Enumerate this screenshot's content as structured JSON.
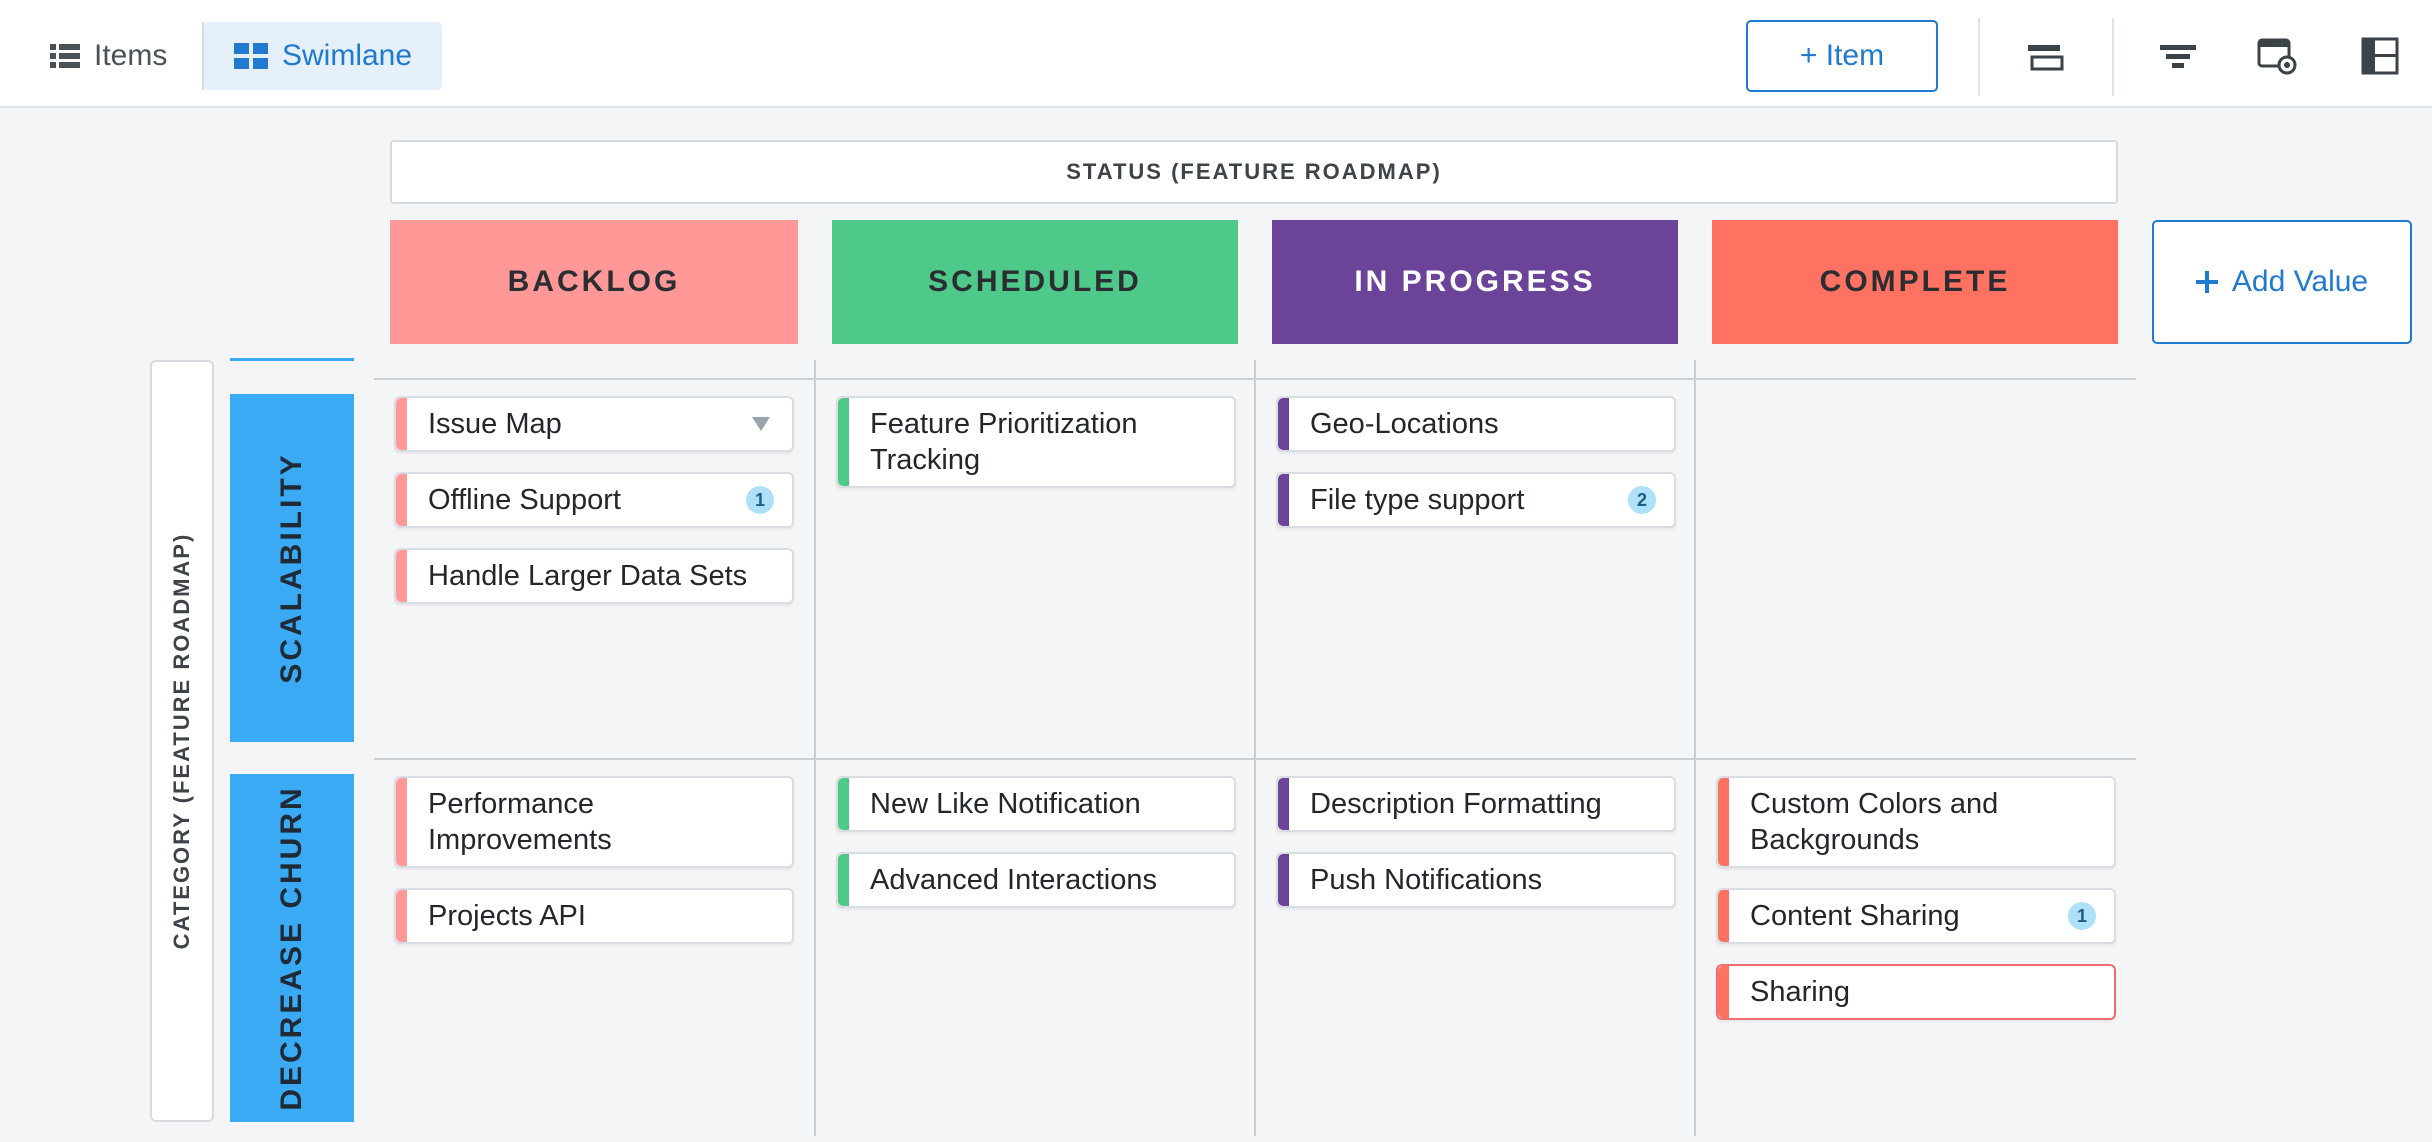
{
  "toolbar": {
    "tabs": [
      {
        "label": "Items",
        "icon": "list-icon"
      },
      {
        "label": "Swimlane",
        "icon": "grid-icon"
      }
    ],
    "add_item_label": "+ Item",
    "tools": [
      "collapse-icon",
      "filter-icon",
      "view-settings-icon",
      "layout-icon"
    ]
  },
  "board": {
    "status_title": "STATUS (FEATURE ROADMAP)",
    "category_title": "CATEGORY (FEATURE ROADMAP)",
    "add_value_label": "Add Value",
    "columns": [
      {
        "label": "BACKLOG",
        "color": "#ff9896"
      },
      {
        "label": "SCHEDULED",
        "color": "#4fc98a"
      },
      {
        "label": "IN PROGRESS",
        "color": "#6b4399"
      },
      {
        "label": "COMPLETE",
        "color": "#ff7160"
      }
    ],
    "row_color": "#3aaaf5",
    "rows": [
      {
        "label": "SCALABILITY",
        "cells": [
          [
            {
              "title": "Issue Map",
              "dropdown": true
            },
            {
              "title": "Offline Support",
              "badge": "1"
            },
            {
              "title": "Handle Larger Data Sets"
            }
          ],
          [
            {
              "title": "Feature Prioritization Tracking"
            }
          ],
          [
            {
              "title": "Geo-Locations"
            },
            {
              "title": "File type support",
              "badge": "2"
            }
          ],
          []
        ]
      },
      {
        "label": "DECREASE CHURN",
        "cells": [
          [
            {
              "title": "Performance Improvements"
            },
            {
              "title": "Projects API"
            }
          ],
          [
            {
              "title": "New Like Notification"
            },
            {
              "title": "Advanced Interactions"
            }
          ],
          [
            {
              "title": "Description Formatting"
            },
            {
              "title": "Push Notifications"
            }
          ],
          [
            {
              "title": "Custom Colors and Backgrounds"
            },
            {
              "title": "Content Sharing",
              "badge": "1"
            },
            {
              "title": "Sharing",
              "selected": true
            }
          ]
        ]
      }
    ]
  }
}
